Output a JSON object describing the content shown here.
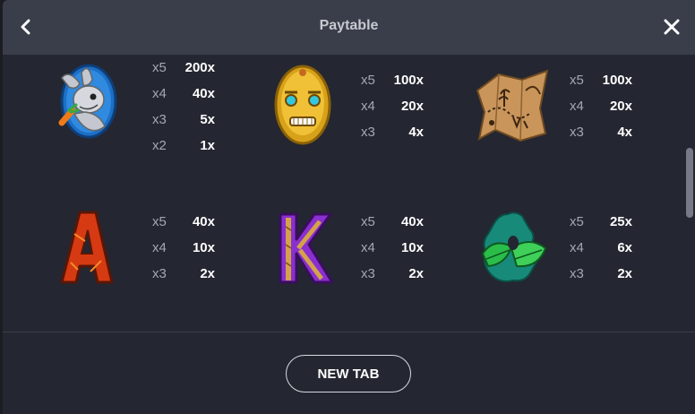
{
  "header": {
    "title": "Paytable",
    "back_icon": "chevron-left-icon",
    "close_icon": "close-icon"
  },
  "symbols": [
    {
      "name": "rabbit-symbol",
      "icon": "rabbit-icon",
      "payouts": [
        {
          "count": "x5",
          "value": "200x"
        },
        {
          "count": "x4",
          "value": "40x"
        },
        {
          "count": "x3",
          "value": "5x"
        },
        {
          "count": "x2",
          "value": "1x"
        }
      ]
    },
    {
      "name": "mask-symbol",
      "icon": "golden-mask-icon",
      "payouts": [
        {
          "count": "x5",
          "value": "100x"
        },
        {
          "count": "x4",
          "value": "20x"
        },
        {
          "count": "x3",
          "value": "4x"
        }
      ]
    },
    {
      "name": "map-symbol",
      "icon": "treasure-map-icon",
      "payouts": [
        {
          "count": "x5",
          "value": "100x"
        },
        {
          "count": "x4",
          "value": "20x"
        },
        {
          "count": "x3",
          "value": "4x"
        }
      ]
    },
    {
      "name": "letter-a-symbol",
      "icon": "letter-a-icon",
      "letter": "A",
      "payouts": [
        {
          "count": "x5",
          "value": "40x"
        },
        {
          "count": "x4",
          "value": "10x"
        },
        {
          "count": "x3",
          "value": "2x"
        }
      ]
    },
    {
      "name": "letter-k-symbol",
      "icon": "letter-k-icon",
      "letter": "K",
      "payouts": [
        {
          "count": "x5",
          "value": "40x"
        },
        {
          "count": "x4",
          "value": "10x"
        },
        {
          "count": "x3",
          "value": "2x"
        }
      ]
    },
    {
      "name": "leaf-symbol",
      "icon": "jungle-leaf-icon",
      "payouts": [
        {
          "count": "x5",
          "value": "25x"
        },
        {
          "count": "x4",
          "value": "6x"
        },
        {
          "count": "x3",
          "value": "2x"
        }
      ]
    }
  ],
  "footer": {
    "button_label": "NEW TAB"
  },
  "colors": {
    "header_bg": "#3a3d4a",
    "panel_bg": "#242631",
    "count_text": "#a6a8b0",
    "value_text": "#ffffff"
  }
}
